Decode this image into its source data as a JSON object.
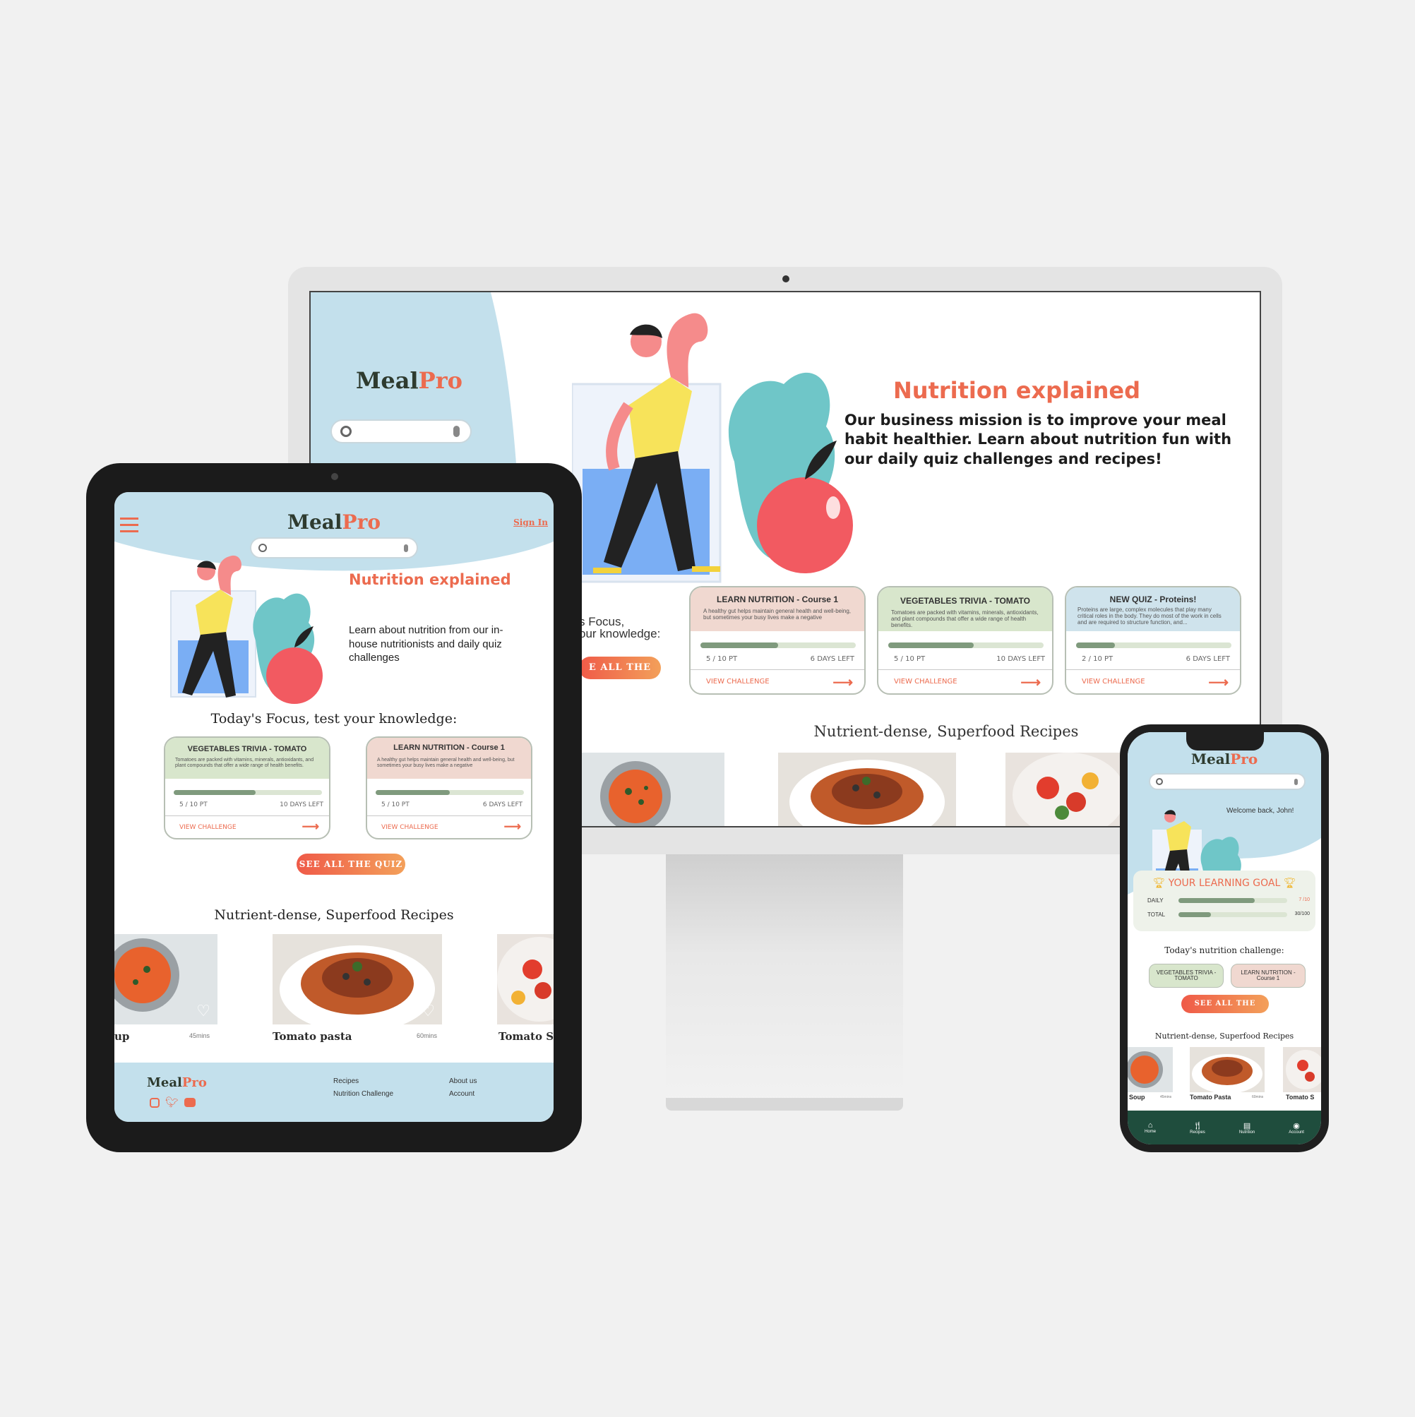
{
  "brand": {
    "meal": "Meal",
    "pro": "Pro"
  },
  "desktop": {
    "hero_title": "Nutrition explained",
    "hero_text": "Our business mission is to improve your meal habit healthier. Learn about nutrition fun with our daily quiz challenges and recipes!",
    "focus_partial_1": "s Focus,",
    "focus_partial_2": "our knowledge:",
    "quiz_button_partial": "E ALL THE QUIZ",
    "recipes_heading": "Nutrient-dense, Superfood Recipes",
    "cards": [
      {
        "title": "LEARN NUTRITION - Course 1",
        "desc": "A healthy gut helps maintain general health and well-being, but sometimes your busy lives make a negative",
        "pts": "5 / 10 PT",
        "days": "6 DAYS LEFT",
        "progress": 0.5,
        "cta": "VIEW CHALLENGE",
        "color": "#f0d8d0"
      },
      {
        "title": "VEGETABLES TRIVIA - TOMATO",
        "desc": "Tomatoes are packed with vitamins, minerals, antioxidants, and plant compounds that offer a wide range of health benefits.",
        "pts": "5 / 10 PT",
        "days": "10 DAYS LEFT",
        "progress": 0.55,
        "cta": "VIEW CHALLENGE",
        "color": "#d8e6cc"
      },
      {
        "title": "NEW QUIZ - Proteins!",
        "desc": "Proteins are large, complex molecules that play many critical roles in the body. They do most of the work in cells and are required to structure function, and...",
        "pts": "2 / 10 PT",
        "days": "6 DAYS LEFT",
        "progress": 0.25,
        "cta": "VIEW CHALLENGE",
        "color": "#cfe3ec"
      }
    ]
  },
  "tablet": {
    "sign_in": "Sign In",
    "hero_title": "Nutrition explained",
    "hero_text": "Learn about nutrition from our in-house nutritionists and daily quiz challenges",
    "focus_heading": "Today's Focus, test your knowledge:",
    "cards": [
      {
        "title": "VEGETABLES TRIVIA - TOMATO",
        "desc": "Tomatoes are packed with vitamins, minerals, antioxidants, and plant compounds that offer a wide range of health benefits.",
        "pts": "5 / 10 PT",
        "days": "10 DAYS LEFT",
        "progress": 0.55,
        "cta": "VIEW CHALLENGE",
        "color": "#d8e6cc"
      },
      {
        "title": "LEARN NUTRITION - Course 1",
        "desc": "A healthy gut helps maintain general health and well-being, but sometimes your busy lives make a negative",
        "pts": "5 / 10 PT",
        "days": "6 DAYS LEFT",
        "progress": 0.5,
        "cta": "VIEW CHALLENGE",
        "color": "#f0d8d0"
      }
    ],
    "quiz_button": "SEE ALL THE QUIZ",
    "recipes_heading": "Nutrient-dense, Superfood Recipes",
    "recipes": [
      {
        "name": "up",
        "time": "45mins"
      },
      {
        "name": "Tomato pasta",
        "time": "60mins"
      },
      {
        "name": "Tomato S",
        "time": ""
      }
    ],
    "footer": {
      "links_col1": [
        "Recipes",
        "Nutrition Challenge"
      ],
      "links_col2": [
        "About us",
        "Account"
      ]
    }
  },
  "phone": {
    "welcome": "Welcome back,  John!",
    "goal_title": "YOUR LEARNING GOAL",
    "daily_label": "DAILY",
    "daily_value": "7 /10",
    "daily_progress": 0.7,
    "total_label": "TOTAL",
    "total_value": "30/100",
    "total_progress": 0.3,
    "challenge_heading": "Today's nutrition challenge:",
    "chips": [
      "VEGETABLES TRIVIA - TOMATO",
      "LEARN NUTRITION - Course 1"
    ],
    "quiz_button": "SEE ALL THE QUIZ",
    "recipes_heading": "Nutrient-dense, Superfood Recipes",
    "recipes": [
      {
        "name": "Soup",
        "time": "45mins"
      },
      {
        "name": "Tomato Pasta",
        "time": "60mins"
      },
      {
        "name": "Tomato S",
        "time": ""
      }
    ],
    "nav": [
      "Home",
      "Recipes",
      "Nutrition",
      "Account"
    ]
  }
}
